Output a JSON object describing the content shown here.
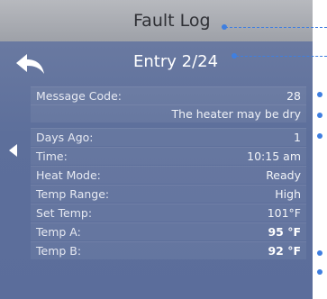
{
  "header": {
    "title": "Fault Log"
  },
  "nav": {
    "entry_label": "Entry 2/24"
  },
  "fault": {
    "message_code_label": "Message Code:",
    "message_code": "28",
    "message_text": "The heater may be dry",
    "rows": [
      {
        "label": "Days Ago:",
        "value": "1"
      },
      {
        "label": "Time:",
        "value": "10:15 am"
      },
      {
        "label": "Heat Mode:",
        "value": "Ready"
      },
      {
        "label": "Temp Range:",
        "value": "High"
      },
      {
        "label": "Set Temp:",
        "value": "101°F"
      },
      {
        "label": "Temp A:",
        "value": "95 °F"
      },
      {
        "label": "Temp B:",
        "value": "92 °F"
      }
    ]
  },
  "colors": {
    "header_bg": "#a8abb2",
    "screen_bg": "#5d6f9b",
    "callout": "#3f7fe0"
  },
  "icons": {
    "back": "back-arrow-icon",
    "prev": "triangle-left-icon",
    "next": "triangle-right-icon"
  }
}
